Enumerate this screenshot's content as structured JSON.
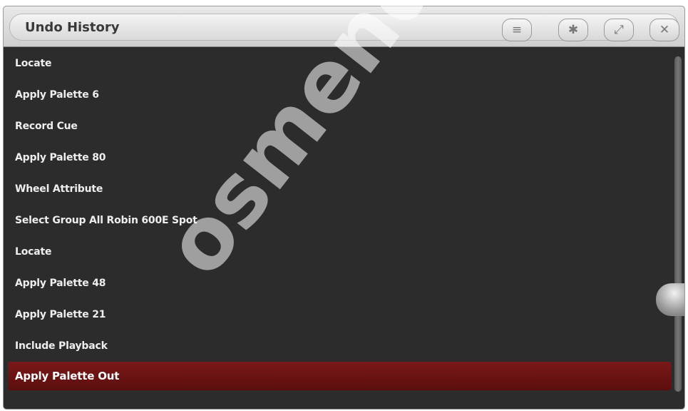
{
  "window": {
    "title": "Undo History"
  },
  "toolbar": {
    "menu_icon": "≡",
    "settings_icon": "✱",
    "expand_icon": "⤢",
    "close_icon": "✕"
  },
  "history": {
    "items": [
      "Locate",
      "Apply Palette  6",
      "Record Cue",
      "Apply Palette  80",
      "Wheel Attribute",
      "Select Group All Robin 600E Spot",
      "Locate",
      "Apply Palette  48",
      "Apply Palette  21",
      "Include Playback",
      "Apply Palette Out"
    ],
    "selected_index": 10
  },
  "watermark": {
    "text": "osmendoza"
  },
  "colors": {
    "selected": "#6e1414",
    "background": "#2c2c2c"
  }
}
